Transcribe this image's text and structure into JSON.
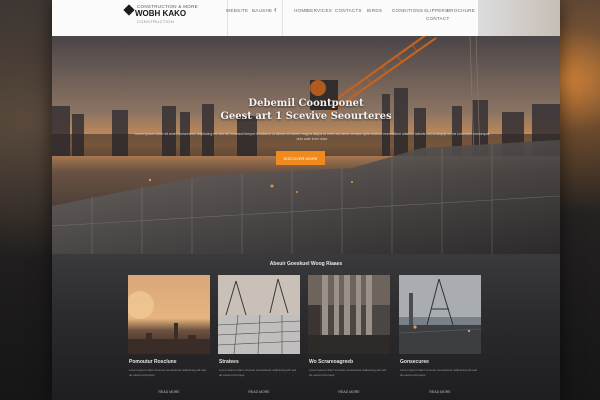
{
  "header": {
    "logo_top": "CONSTRUCTION & MORE",
    "logo_main": "WOBH KAKO",
    "logo_sub": "CONSTRUCTION",
    "nav": [
      "WEBSITE",
      "BAUSHE",
      "HOME",
      "SERVICES",
      "CONTACTS",
      "BIRDS",
      "CONDITIONS",
      "SLIPPERS",
      "CONTACT",
      "BROCHURE"
    ],
    "nav_back": "‹"
  },
  "hero": {
    "title_line1": "Debemil Coontponet",
    "title_line2": "Geest art 1 Scevive Seourteres",
    "description": "Lorem ipsum dolor sit amet consectetur adipiscing elit sed do eiusmod tempor incididunt ut labore et dolore magna aliqua ut enim ad minim veniam quis nostrud exercitation ullamco laboris nisi ut aliquip ex ea commodo consequat duis aute irure dolor",
    "cta_label": "DISCOVER MORE"
  },
  "section": {
    "title": "Abeuir Goeskuel Woog Riaaes",
    "cards": [
      {
        "title": "Pomoutur Rosclune",
        "text": "Lorem ipsum dolor sit amet consectetur adipiscing elit sed do eiusmod tempor",
        "link": "READ MORE"
      },
      {
        "title": "Stratees",
        "text": "Lorem ipsum dolor sit amet consectetur adipiscing elit sed do eiusmod tempor",
        "link": "READ MORE"
      },
      {
        "title": "Wo Scrareoagreeb",
        "text": "Lorem ipsum dolor sit amet consectetur adipiscing elit sed do eiusmod tempor",
        "link": "READ MORE"
      },
      {
        "title": "Gonsecuree",
        "text": "Lorem ipsum dolor sit amet consectetur adipiscing elit sed do eiusmod tempor",
        "link": "READ MORE"
      }
    ]
  },
  "colors": {
    "accent": "#f08a1c",
    "header_bg": "#fbfbfb",
    "page_bg": "#232325"
  }
}
